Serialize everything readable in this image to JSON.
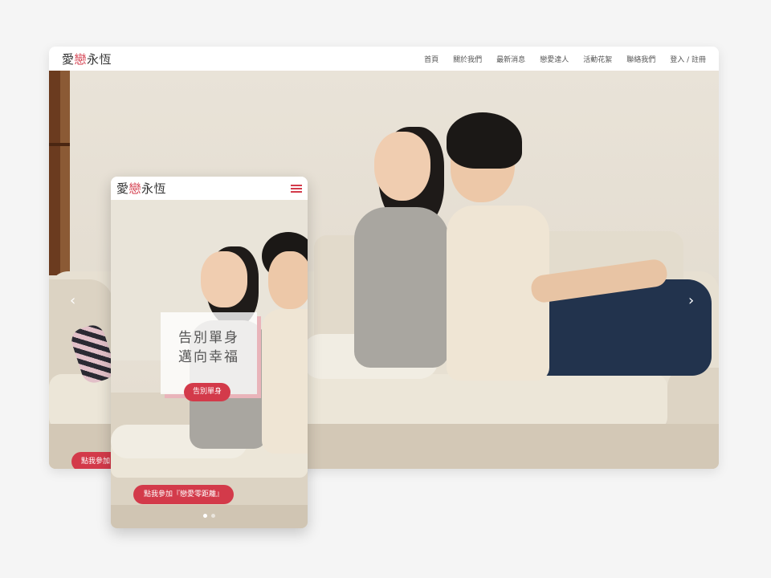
{
  "brand": {
    "logo_part1": "愛",
    "logo_part2": "戀",
    "logo_part3": "永恆",
    "accent_color": "#d33a4a"
  },
  "desktop": {
    "nav": [
      "首頁",
      "關於我們",
      "最新消息",
      "戀愛達人",
      "活動花絮",
      "聯絡我們",
      "登入 / 註冊"
    ],
    "cta_label": "點我參加",
    "prev_icon": "chevron-left-icon",
    "next_icon": "chevron-right-icon"
  },
  "mobile": {
    "menu_icon": "hamburger-menu-icon",
    "tagline": "告別單身\n邁向幸福",
    "tag_button": "告別單身",
    "cta_label": "點我參加『戀愛零距離』",
    "slides": {
      "count": 2,
      "active_index": 0
    }
  }
}
